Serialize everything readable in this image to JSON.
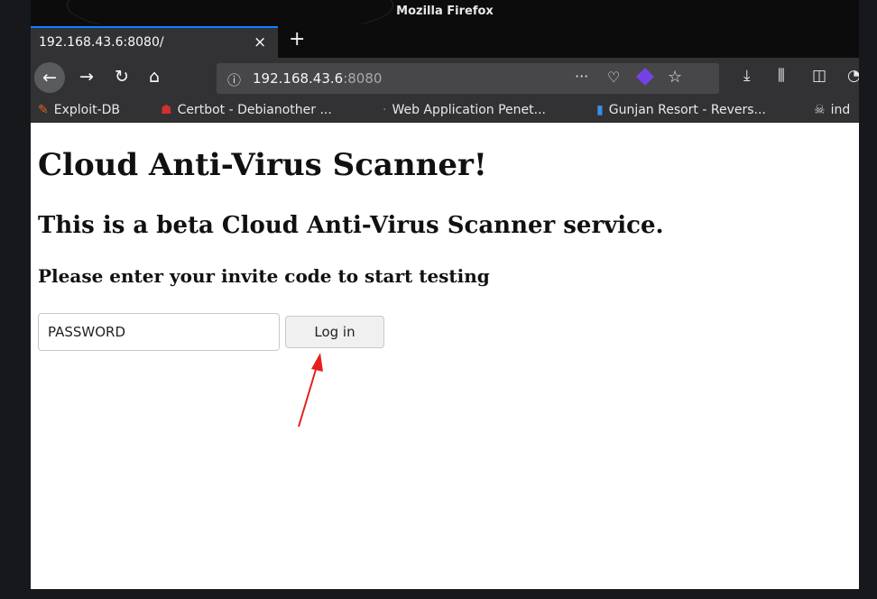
{
  "window": {
    "title": "Mozilla Firefox"
  },
  "tabs": [
    {
      "label": "192.168.43.6:8080/",
      "close": "×"
    }
  ],
  "newtab": "+",
  "nav": {
    "back": "←",
    "forward": "→",
    "reload": "↻",
    "home": "⌂",
    "info_icon": "ⓘ",
    "url_host": "192.168.43.6",
    "url_port": ":8080",
    "more": "···",
    "pocket": "♡",
    "star": "☆",
    "download": "⤓",
    "library": "⫼",
    "sidebar": "◫"
  },
  "bookmarks": [
    {
      "label": "Exploit-DB",
      "icon": "✎",
      "color": "#e06020"
    },
    {
      "label": "Certbot - Debianother ...",
      "icon": "☗",
      "color": "#d03030"
    },
    {
      "label": "Web Application Penet...",
      "icon": "·",
      "color": "#888888"
    },
    {
      "label": "Gunjan Resort - Revers...",
      "icon": "▮",
      "color": "#3a8ee6"
    },
    {
      "label": "ind",
      "icon": "☠",
      "color": "#cccccc"
    }
  ],
  "page": {
    "h1": "Cloud Anti-Virus Scanner!",
    "h2": "This is a beta Cloud Anti-Virus Scanner service.",
    "h3": "Please enter your invite code to start testing",
    "input_value": "PASSWORD",
    "login_label": "Log in"
  },
  "colors": {
    "arrow": "#e8201a",
    "tab_accent": "#0a84ff"
  }
}
